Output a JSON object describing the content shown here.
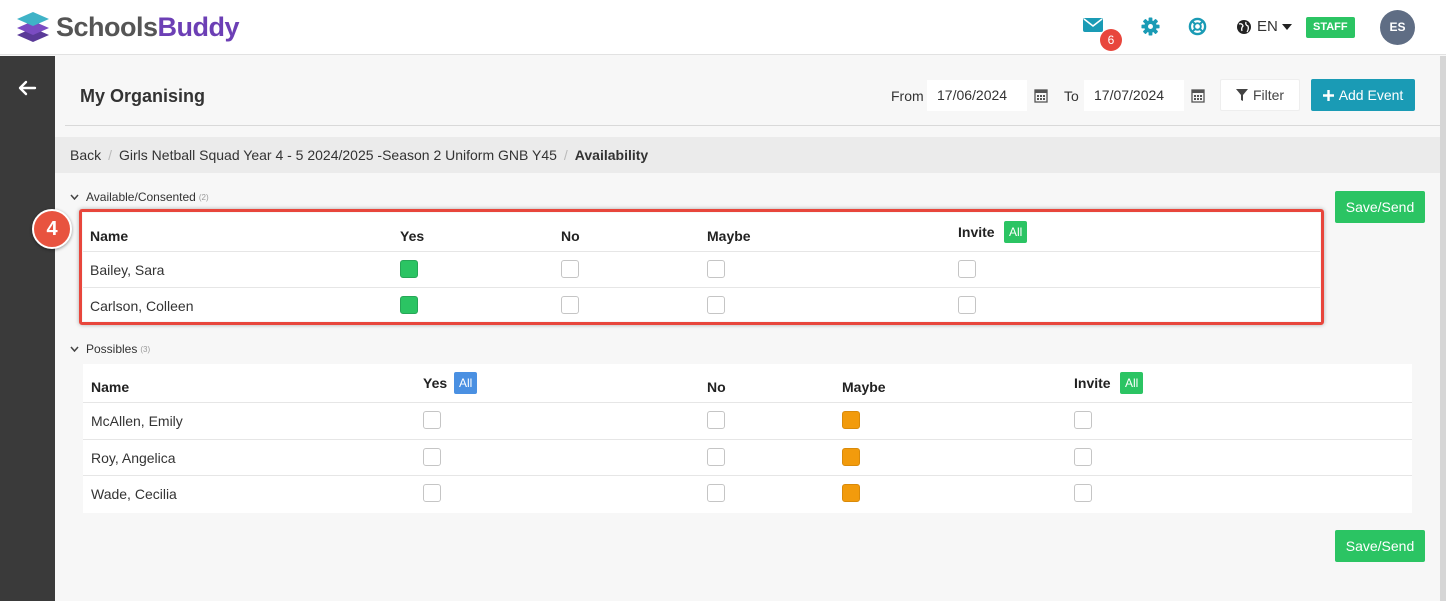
{
  "header": {
    "logo": {
      "part1": "Schools",
      "part2": "Buddy"
    },
    "mail_count": "6",
    "language": "EN",
    "staff_label": "STAFF",
    "avatar_initials": "ES",
    "icons": [
      "mail-icon",
      "gear-icon",
      "lifebuoy-icon",
      "globe-icon"
    ],
    "accent_color": "#1a9bb5"
  },
  "toolbar": {
    "title": "My Organising",
    "from_label": "From",
    "from_date": "17/06/2024",
    "to_label": "To",
    "to_date": "17/07/2024",
    "filter_label": "Filter",
    "add_event_label": "Add Event"
  },
  "breadcrumb": {
    "back": "Back",
    "event": "Girls Netball Squad Year 4 - 5 2024/2025 -Season 2 Uniform GNB Y45",
    "current": "Availability"
  },
  "step_badge": "4",
  "available": {
    "title": "Available/Consented",
    "count": "(2)",
    "save_label": "Save/Send",
    "columns": {
      "name": "Name",
      "yes": "Yes",
      "no": "No",
      "maybe": "Maybe",
      "invite": "Invite",
      "invite_all": "All"
    },
    "rows": [
      {
        "name": "Bailey, Sara",
        "yes": true,
        "no": false,
        "maybe": false,
        "invite": false
      },
      {
        "name": "Carlson, Colleen",
        "yes": true,
        "no": false,
        "maybe": false,
        "invite": false
      }
    ]
  },
  "possibles": {
    "title": "Possibles",
    "count": "(3)",
    "save_label": "Save/Send",
    "columns": {
      "name": "Name",
      "yes": "Yes",
      "yes_all": "All",
      "no": "No",
      "maybe": "Maybe",
      "invite": "Invite",
      "invite_all": "All"
    },
    "rows": [
      {
        "name": "McAllen, Emily",
        "yes": false,
        "no": false,
        "maybe": true,
        "invite": false
      },
      {
        "name": "Roy, Angelica",
        "yes": false,
        "no": false,
        "maybe": true,
        "invite": false
      },
      {
        "name": "Wade, Cecilia",
        "yes": false,
        "no": false,
        "maybe": true,
        "invite": false
      }
    ]
  }
}
